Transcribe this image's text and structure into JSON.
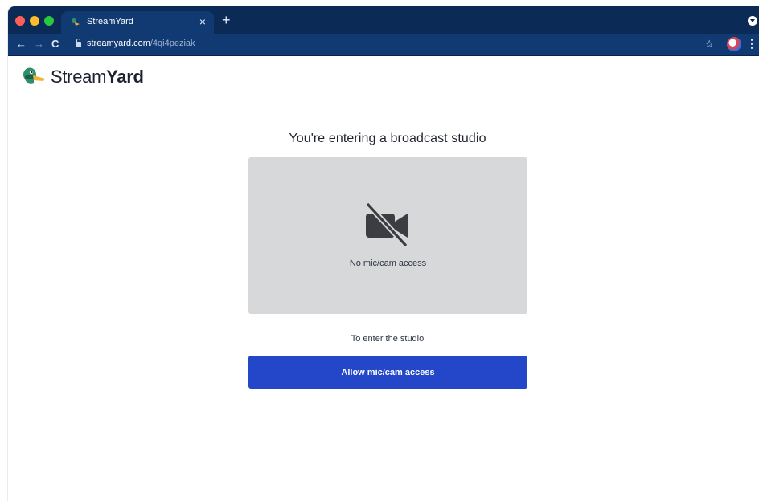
{
  "browser": {
    "tab_title": "StreamYard",
    "tab_close": "×",
    "new_tab": "+",
    "url_domain": "streamyard.com",
    "url_path": "/4qi4peziak",
    "nav": {
      "back": "←",
      "forward": "→",
      "reload": "C"
    },
    "star": "☆",
    "menu": "⋮",
    "chrome_color": "#0b2a55",
    "toolbar_color": "#113a73"
  },
  "brand": {
    "name_light": "Stream",
    "name_bold": "Yard",
    "logo_icon": "duck-logo-icon"
  },
  "studio": {
    "heading": "You're entering a broadcast studio",
    "preview_icon": "camera-off-icon",
    "preview_caption": "No mic/cam access",
    "subtext": "To enter the studio",
    "allow_button": "Allow mic/cam access",
    "button_color": "#2347c8",
    "preview_bg": "#d7d8da"
  }
}
